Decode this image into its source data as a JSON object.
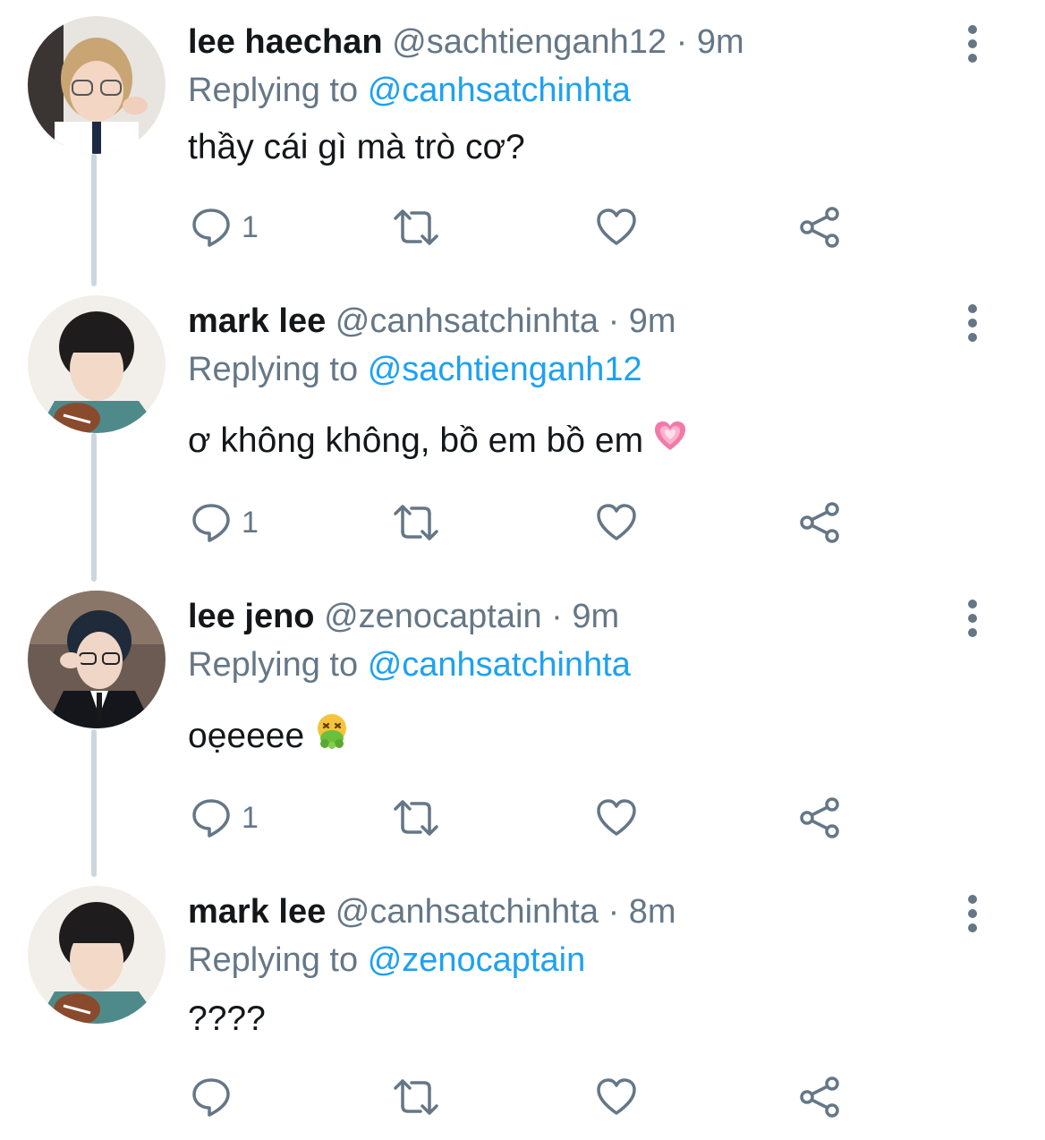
{
  "tweets": [
    {
      "name": "lee haechan",
      "handle": "@sachtienganh12",
      "separator": "·",
      "time": "9m",
      "replying_prefix": "Replying to",
      "replying_to": "@canhsatchinhta",
      "text": "thầy cái gì mà trò cơ?",
      "reply_count": "1",
      "emoji": ""
    },
    {
      "name": "mark lee",
      "handle": "@canhsatchinhta",
      "separator": "·",
      "time": "9m",
      "replying_prefix": "Replying to",
      "replying_to": "@sachtienganh12",
      "text": "ơ không không, bồ em bồ em",
      "reply_count": "1",
      "emoji": "growing-heart-emoji"
    },
    {
      "name": "lee jeno",
      "handle": "@zenocaptain",
      "separator": "·",
      "time": "9m",
      "replying_prefix": "Replying to",
      "replying_to": "@canhsatchinhta",
      "text": "oẹeeee",
      "reply_count": "1",
      "emoji": "vomiting-face-emoji"
    },
    {
      "name": "mark lee",
      "handle": "@canhsatchinhta",
      "separator": "·",
      "time": "8m",
      "replying_prefix": "Replying to",
      "replying_to": "@zenocaptain",
      "text": "????",
      "reply_count": "",
      "emoji": ""
    }
  ],
  "icons": {
    "reply": "reply-bubble-icon",
    "retweet": "retweet-icon",
    "like": "heart-icon",
    "share": "share-icon",
    "more": "more-vertical-icon"
  },
  "colors": {
    "text": "#14171a",
    "secondary": "#657786",
    "link": "#1da1f2",
    "thread_line": "#ccd6dd"
  }
}
